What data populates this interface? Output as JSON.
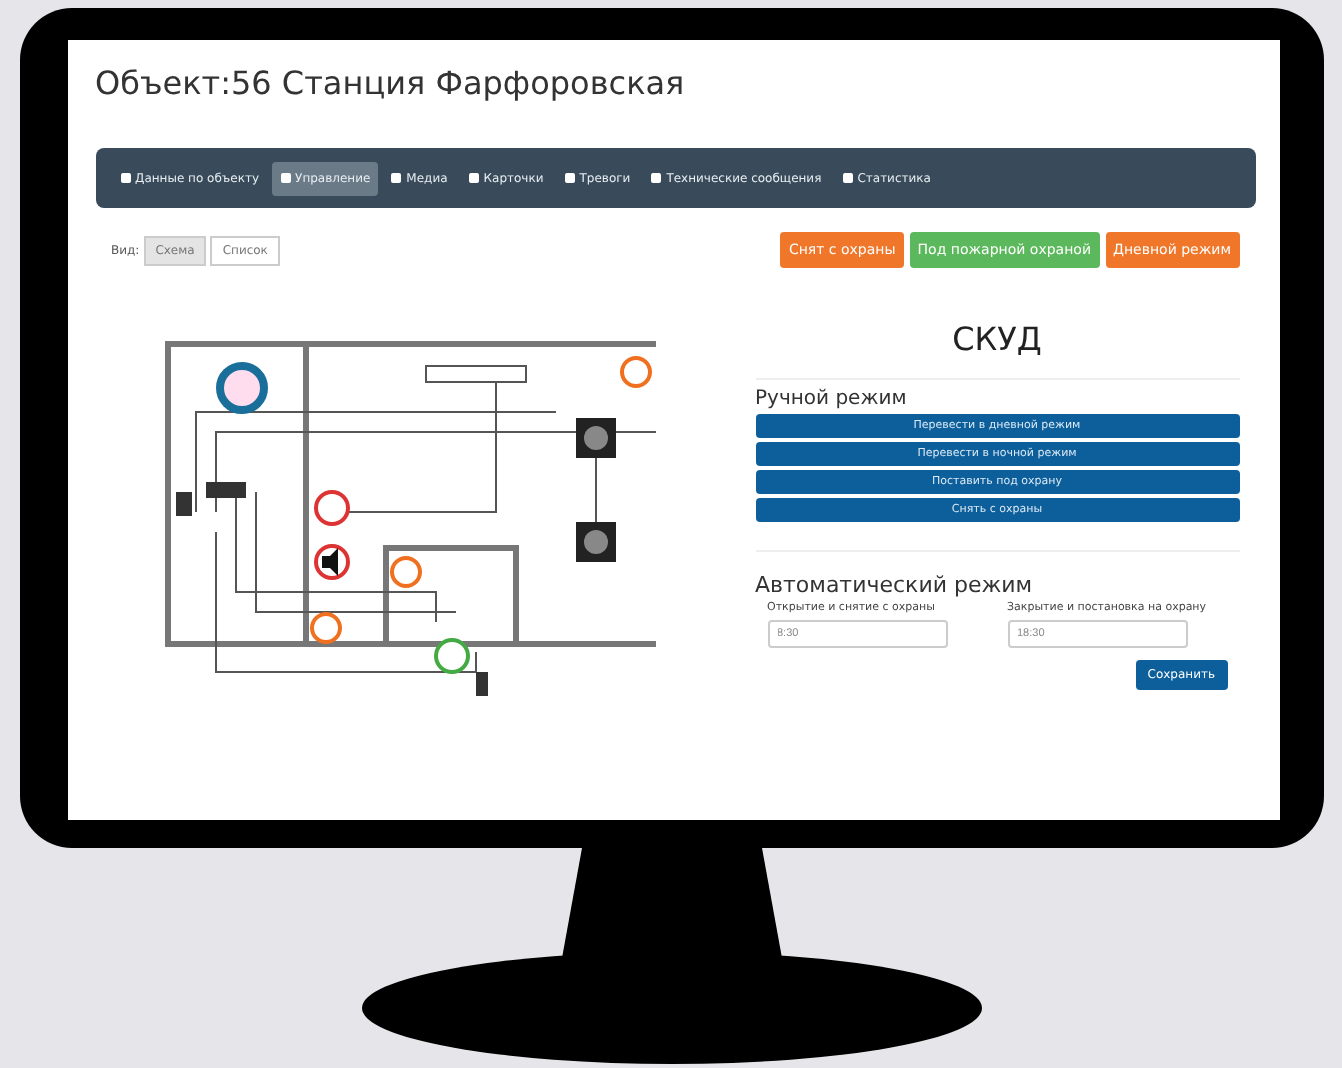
{
  "page_title": "Объект:56 Станция Фарфоровская",
  "tabs": [
    {
      "label": "Данные по объекту",
      "selected": false
    },
    {
      "label": "Управление",
      "selected": true
    },
    {
      "label": "Медиа",
      "selected": false
    },
    {
      "label": "Карточки",
      "selected": false
    },
    {
      "label": "Тревоги",
      "selected": false
    },
    {
      "label": "Технические сообщения",
      "selected": false
    },
    {
      "label": "Статистика",
      "selected": false
    }
  ],
  "view": {
    "label": "Вид:",
    "options": [
      {
        "label": "Схема",
        "selected": true
      },
      {
        "label": "Список",
        "selected": false
      }
    ]
  },
  "status_buttons": [
    {
      "label": "Снят с охраны",
      "color": "#f0772a"
    },
    {
      "label": "Под пожарной охраной",
      "color": "#5cb85c"
    },
    {
      "label": "Дневной режим",
      "color": "#f0772a"
    }
  ],
  "panel": {
    "title": "СКУД",
    "manual_heading": "Ручной режим",
    "manual_buttons": [
      "Перевести в дневной режим",
      "Перевести в ночной режим",
      "Поставить под охрану",
      "Снять с охраны"
    ],
    "auto_heading": "Автоматический режим",
    "fields": [
      {
        "label": "Открытие и снятие с охраны",
        "value": "8:30"
      },
      {
        "label": "Закрытие и постановка на охрану",
        "value": "18:30"
      }
    ],
    "save_button": "Сохранить"
  }
}
